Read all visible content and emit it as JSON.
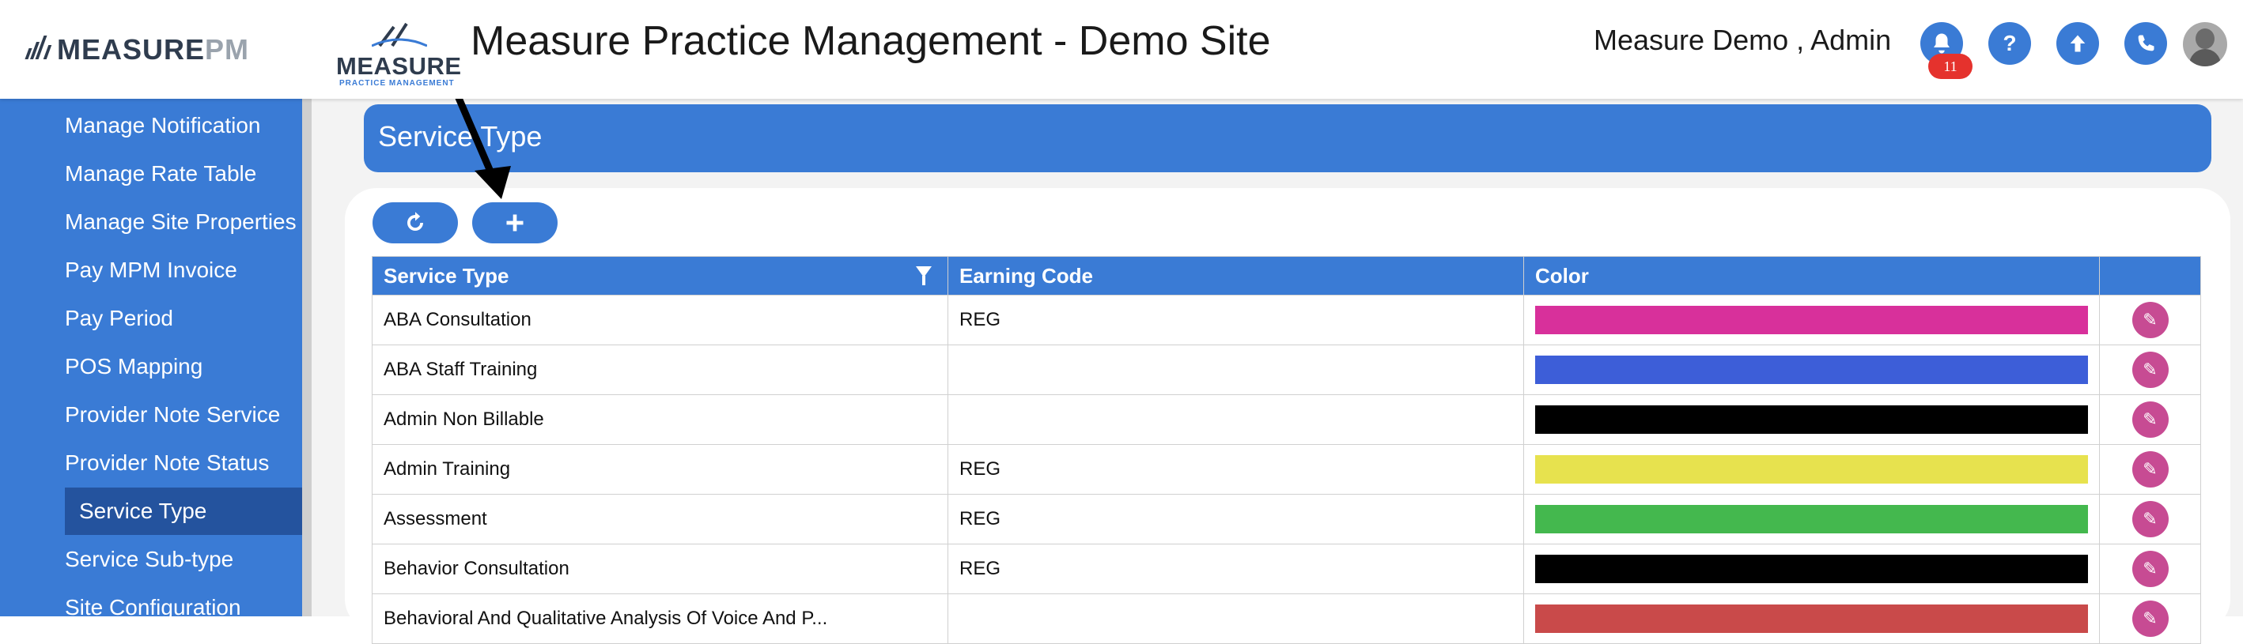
{
  "header": {
    "brand_prefix": "MEASURE",
    "brand_suffix": "PM",
    "logo_text": "MEASURE",
    "logo_subtext": "PRACTICE MANAGEMENT",
    "title": "Measure Practice Management - Demo Site",
    "user": "Measure Demo , Admin",
    "notification_count": "11",
    "icons": [
      "bell-icon",
      "help-icon",
      "upload-icon",
      "phone-icon"
    ]
  },
  "sidebar": {
    "items": [
      {
        "label": "Manage Notification"
      },
      {
        "label": "Manage Rate Table"
      },
      {
        "label": "Manage Site Properties"
      },
      {
        "label": "Pay MPM Invoice"
      },
      {
        "label": "Pay Period"
      },
      {
        "label": "POS Mapping"
      },
      {
        "label": "Provider Note Service"
      },
      {
        "label": "Provider Note Status"
      },
      {
        "label": "Service Type",
        "active": true
      },
      {
        "label": "Service Sub-type"
      },
      {
        "label": "Site Configuration"
      }
    ]
  },
  "page": {
    "title": "Service Type"
  },
  "toolbar": {
    "refresh_icon": "refresh-icon",
    "add_icon": "plus-icon"
  },
  "table": {
    "columns": [
      "Service Type",
      "Earning Code",
      "Color",
      ""
    ],
    "rows": [
      {
        "service_type": "ABA Consultation",
        "earning_code": "REG",
        "color": "#d8309b"
      },
      {
        "service_type": "ABA Staff Training",
        "earning_code": "",
        "color": "#3d5ed8"
      },
      {
        "service_type": "Admin Non Billable",
        "earning_code": "",
        "color": "#000000"
      },
      {
        "service_type": "Admin Training",
        "earning_code": "REG",
        "color": "#e7e24e"
      },
      {
        "service_type": "Assessment",
        "earning_code": "REG",
        "color": "#44b84e"
      },
      {
        "service_type": "Behavior Consultation",
        "earning_code": "REG",
        "color": "#000000"
      },
      {
        "service_type": "Behavioral And Qualitative Analysis Of Voice And P...",
        "earning_code": "",
        "color": "#c94a4a"
      }
    ]
  },
  "colors": {
    "primary": "#3a7bd5",
    "sidebar_active": "#24539e",
    "edit_button": "#c74b93",
    "badge": "#e5322d"
  }
}
